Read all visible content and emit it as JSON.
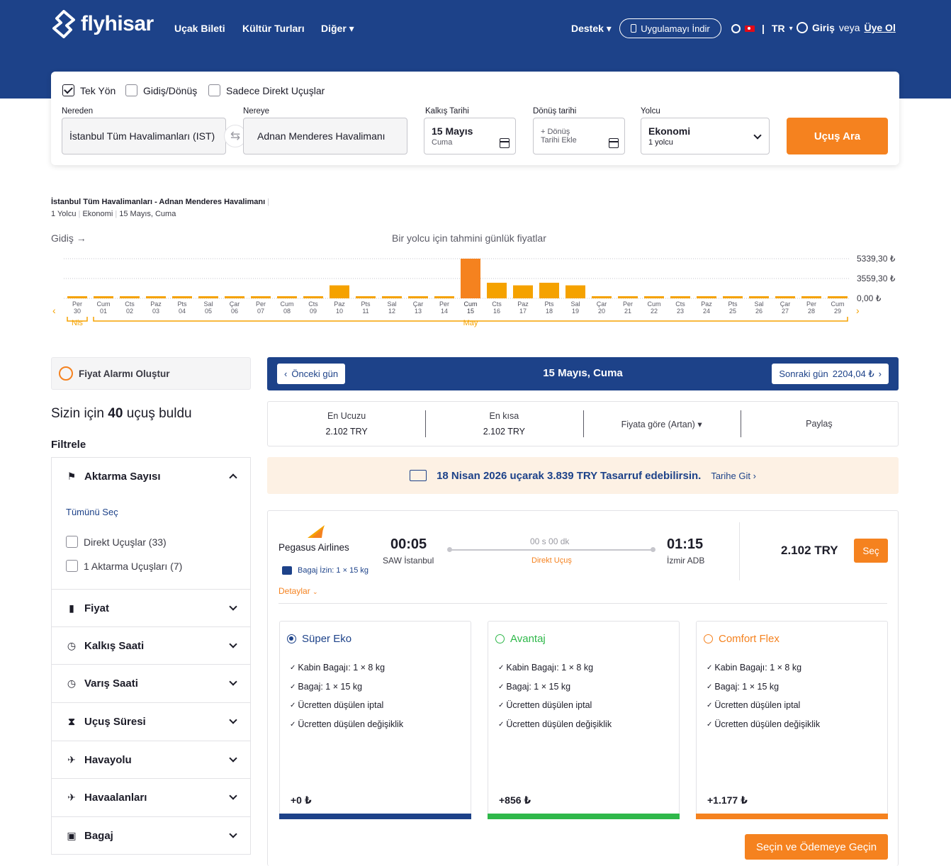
{
  "colors": {
    "brand": "#1d4289",
    "accent": "#f5821f",
    "bar": "#f5a200",
    "bar_peak": "#f5821f",
    "green": "#2fb84a"
  },
  "header": {
    "logo_text": "flyhisar",
    "nav": [
      "Uçak Bileti",
      "Kültür Turları",
      "Diğer"
    ],
    "support": "Destek",
    "download_app": "Uygulamayı İndir",
    "language": "TR",
    "login": "Giriş",
    "or": "veya",
    "register": "Üye Ol"
  },
  "search": {
    "trip_types": [
      {
        "label": "Tek Yön",
        "checked": true
      },
      {
        "label": "Gidiş/Dönüş",
        "checked": false
      },
      {
        "label": "Sadece Direkt Uçuşlar",
        "checked": false
      }
    ],
    "from_label": "Nereden",
    "from_value": "İstanbul Tüm Havalimanları (IST)",
    "to_label": "Nereye",
    "to_value": "Adnan Menderes Havalimanı",
    "depart_label": "Kalkış Tarihi",
    "depart_date": "15 Mayıs",
    "depart_day": "Cuma",
    "return_label": "Dönüş tarihi",
    "return_line1": "+ Dönüş",
    "return_line2": "Tarihi Ekle",
    "pax_label": "Yolcu",
    "cabin": "Ekonomi",
    "pax": "1 yolcu",
    "button": "Uçuş Ara"
  },
  "summary": {
    "route": "İstanbul Tüm Havalimanları - Adnan Menderes Havalimanı",
    "pax": "1 Yolcu",
    "cabin": "Ekonomi",
    "date": "15 Mayıs, Cuma"
  },
  "chart_data": {
    "type": "bar",
    "title": "Bir yolcu için tahmini günlük fiyatlar",
    "direction_label": "Gidiş →",
    "y_ticks": [
      "5339,30 ₺",
      "3559,30 ₺",
      "0,00 ₺"
    ],
    "ylim": [
      0,
      5339.3
    ],
    "categories": [
      {
        "dow": "Per",
        "day": "30"
      },
      {
        "dow": "Cum",
        "day": "01"
      },
      {
        "dow": "Cts",
        "day": "02"
      },
      {
        "dow": "Paz",
        "day": "03"
      },
      {
        "dow": "Pts",
        "day": "04"
      },
      {
        "dow": "Sal",
        "day": "05"
      },
      {
        "dow": "Çar",
        "day": "06"
      },
      {
        "dow": "Per",
        "day": "07"
      },
      {
        "dow": "Cum",
        "day": "08"
      },
      {
        "dow": "Cts",
        "day": "09"
      },
      {
        "dow": "Paz",
        "day": "10"
      },
      {
        "dow": "Pts",
        "day": "11"
      },
      {
        "dow": "Sal",
        "day": "12"
      },
      {
        "dow": "Çar",
        "day": "13"
      },
      {
        "dow": "Per",
        "day": "14"
      },
      {
        "dow": "Cum",
        "day": "15"
      },
      {
        "dow": "Cts",
        "day": "16"
      },
      {
        "dow": "Paz",
        "day": "17"
      },
      {
        "dow": "Pts",
        "day": "18"
      },
      {
        "dow": "Sal",
        "day": "19"
      },
      {
        "dow": "Çar",
        "day": "20"
      },
      {
        "dow": "Per",
        "day": "21"
      },
      {
        "dow": "Cum",
        "day": "22"
      },
      {
        "dow": "Cts",
        "day": "23"
      },
      {
        "dow": "Paz",
        "day": "24"
      },
      {
        "dow": "Pts",
        "day": "25"
      },
      {
        "dow": "Sal",
        "day": "26"
      },
      {
        "dow": "Çar",
        "day": "27"
      },
      {
        "dow": "Per",
        "day": "28"
      },
      {
        "dow": "Cum",
        "day": "29"
      }
    ],
    "values": [
      0,
      0,
      0,
      0,
      0,
      0,
      0,
      0,
      0,
      0,
      1750,
      0,
      0,
      0,
      0,
      5339.3,
      2100,
      1750,
      2100,
      1750,
      0,
      0,
      0,
      0,
      0,
      0,
      0,
      0,
      0,
      0
    ],
    "selected_index": 15,
    "month_groups": [
      {
        "label": "Nis",
        "from": 0,
        "to": 0
      },
      {
        "label": "May",
        "from": 1,
        "to": 29
      }
    ]
  },
  "sidebar": {
    "alarm": "Fiyat Alarmı Oluştur",
    "found_prefix": "Sizin için",
    "found_count": "40",
    "found_suffix": "uçuş buldu",
    "filter_title": "Filtrele",
    "stops_title": "Aktarma Sayısı",
    "select_all": "Tümünü Seç",
    "stop_options": [
      "Direkt Uçuşlar (33)",
      "1 Aktarma Uçuşları (7)"
    ],
    "filters": [
      "Fiyat",
      "Kalkış Saati",
      "Varış Saati",
      "Uçuş Süresi",
      "Havayolu",
      "Havaalanları",
      "Bagaj"
    ]
  },
  "results": {
    "prev_day": "Önceki gün",
    "day_title": "15 Mayıs, Cuma",
    "next_day": "Sonraki gün",
    "next_day_price": "2204,04 ₺",
    "sort": [
      {
        "label": "En Ucuzu",
        "value": "2.102 TRY"
      },
      {
        "label": "En kısa",
        "value": "2.102 TRY"
      },
      {
        "label": "Fiyata göre (Artan)",
        "value": ""
      },
      {
        "label": "Paylaş",
        "value": ""
      }
    ],
    "savings_text": "18 Nisan 2026 uçarak 3.839 TRY Tasarruf edebilirsin.",
    "savings_link": "Tarihe Git",
    "flight": {
      "airline": "Pegasus Airlines",
      "baggage": "Bagaj İzin: 1 × 15 kg",
      "details": "Detaylar",
      "dep_time": "00:05",
      "dep_airport": "SAW İstanbul",
      "duration": "00 s 00 dk",
      "type": "Direkt Uçuş",
      "arr_time": "01:15",
      "arr_airport": "İzmir ADB",
      "price": "2.102 TRY",
      "select": "Seç"
    },
    "packages": [
      {
        "name": "Süper Eko",
        "color": "#1d4289",
        "selected": true,
        "features": [
          "Kabin Bagajı: 1 × 8 kg",
          "Bagaj: 1 × 15 kg",
          "Ücretten düşülen iptal",
          "Ücretten düşülen değişiklik"
        ],
        "price": "+0 ₺"
      },
      {
        "name": "Avantaj",
        "color": "#2fb84a",
        "selected": false,
        "features": [
          "Kabin Bagajı: 1 × 8 kg",
          "Bagaj: 1 × 15 kg",
          "Ücretten düşülen iptal",
          "Ücretten düşülen değişiklik"
        ],
        "price": "+856 ₺"
      },
      {
        "name": "Comfort Flex",
        "color": "#f5821f",
        "selected": false,
        "features": [
          "Kabin Bagajı: 1 × 8 kg",
          "Bagaj: 1 × 15 kg",
          "Ücretten düşülen iptal",
          "Ücretten düşülen değişiklik"
        ],
        "price": "+1.177 ₺"
      }
    ],
    "pay_button": "Seçin ve Ödemeye Geçin"
  }
}
